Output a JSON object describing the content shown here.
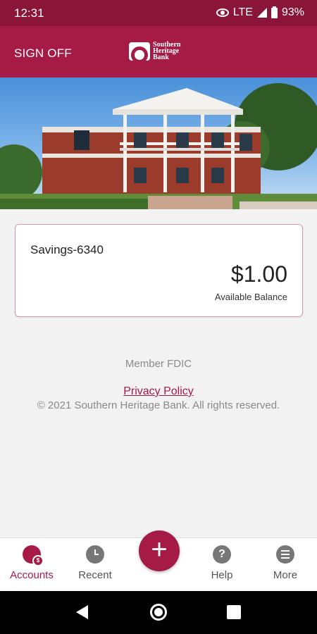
{
  "status_bar": {
    "time": "12:31",
    "network": "LTE",
    "battery": "93%"
  },
  "header": {
    "sign_off_label": "SIGN OFF",
    "logo_text": [
      "Southern",
      "Heritage",
      "Bank"
    ]
  },
  "account": {
    "name": "Savings-6340",
    "balance": "$1.00",
    "balance_label": "Available Balance"
  },
  "footer": {
    "member_fdic": "Member FDIC",
    "privacy_link": "Privacy Policy",
    "copyright": "© 2021 Southern Heritage Bank. All rights reserved."
  },
  "tabs": {
    "accounts": "Accounts",
    "accounts_badge": "$",
    "recent": "Recent",
    "add": "+",
    "help": "Help",
    "help_icon": "?",
    "more": "More"
  },
  "colors": {
    "brand": "#a51b46",
    "status_bar": "#8b1538"
  }
}
